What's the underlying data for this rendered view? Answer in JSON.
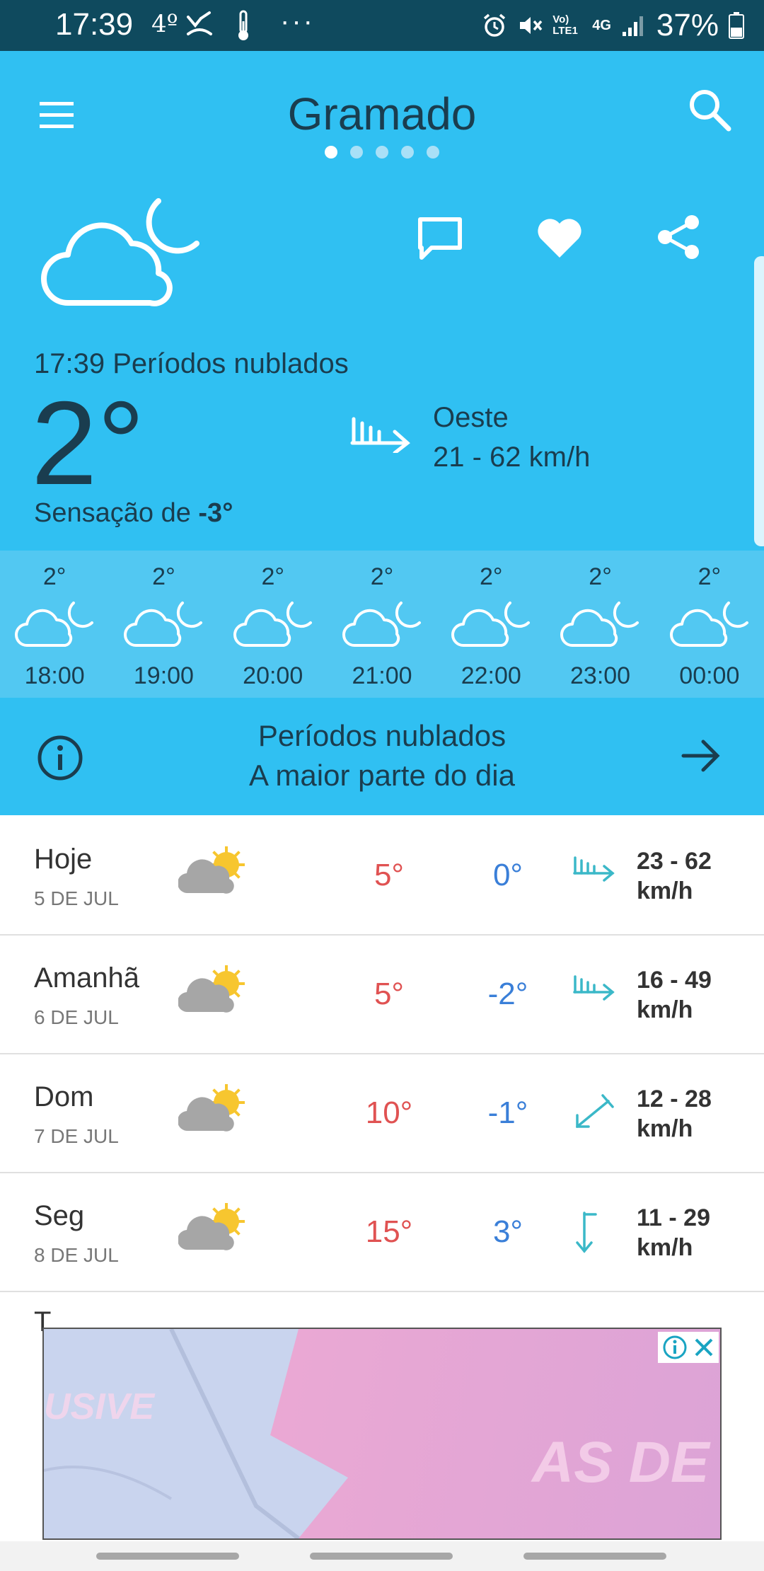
{
  "status_bar": {
    "time": "17:39",
    "temp_indicator": "4º",
    "more": "···",
    "network": "4G",
    "volte": "Vo) LTE1",
    "battery": "37%"
  },
  "header": {
    "city": "Gramado",
    "page_count": 5,
    "active_page": 1
  },
  "current": {
    "condition_line": "17:39 Períodos nublados",
    "temp": "2°",
    "feels_prefix": "Sensação de ",
    "feels_value": "-3°",
    "wind_direction": "Oeste",
    "wind_speed": "21 - 62 km/h"
  },
  "hourly": [
    {
      "temp": "2°",
      "time": "18:00"
    },
    {
      "temp": "2°",
      "time": "19:00"
    },
    {
      "temp": "2°",
      "time": "20:00"
    },
    {
      "temp": "2°",
      "time": "21:00"
    },
    {
      "temp": "2°",
      "time": "22:00"
    },
    {
      "temp": "2°",
      "time": "23:00"
    },
    {
      "temp": "2°",
      "time": "00:00"
    }
  ],
  "summary": {
    "line1": "Períodos nublados",
    "line2": "A maior parte do dia"
  },
  "daily": [
    {
      "name": "Hoje",
      "date": "5 DE JUL",
      "max": "5°",
      "min": "0°",
      "wind": "23 - 62",
      "unit": "km/h",
      "wind_icon": "wind-west-icon"
    },
    {
      "name": "Amanhã",
      "date": "6 DE JUL",
      "max": "5°",
      "min": "-2°",
      "wind": "16 - 49",
      "unit": "km/h",
      "wind_icon": "wind-west-icon"
    },
    {
      "name": "Dom",
      "date": "7 DE JUL",
      "max": "10°",
      "min": "-1°",
      "wind": "12 - 28",
      "unit": "km/h",
      "wind_icon": "wind-southwest-icon"
    },
    {
      "name": "Seg",
      "date": "8 DE JUL",
      "max": "15°",
      "min": "3°",
      "wind": "11 - 29",
      "unit": "km/h",
      "wind_icon": "wind-north-icon"
    }
  ],
  "partial_row_letter": "T",
  "ad": {
    "text_left": "USIVE",
    "text_right": "AS DE"
  },
  "colors": {
    "header_bg": "#30c0f2",
    "hourly_bg": "#52c8f2",
    "status_bg": "#0f4a5e",
    "max_temp": "#e05252",
    "min_temp": "#3a7fd8",
    "wind_icon": "#3bb8c8"
  }
}
